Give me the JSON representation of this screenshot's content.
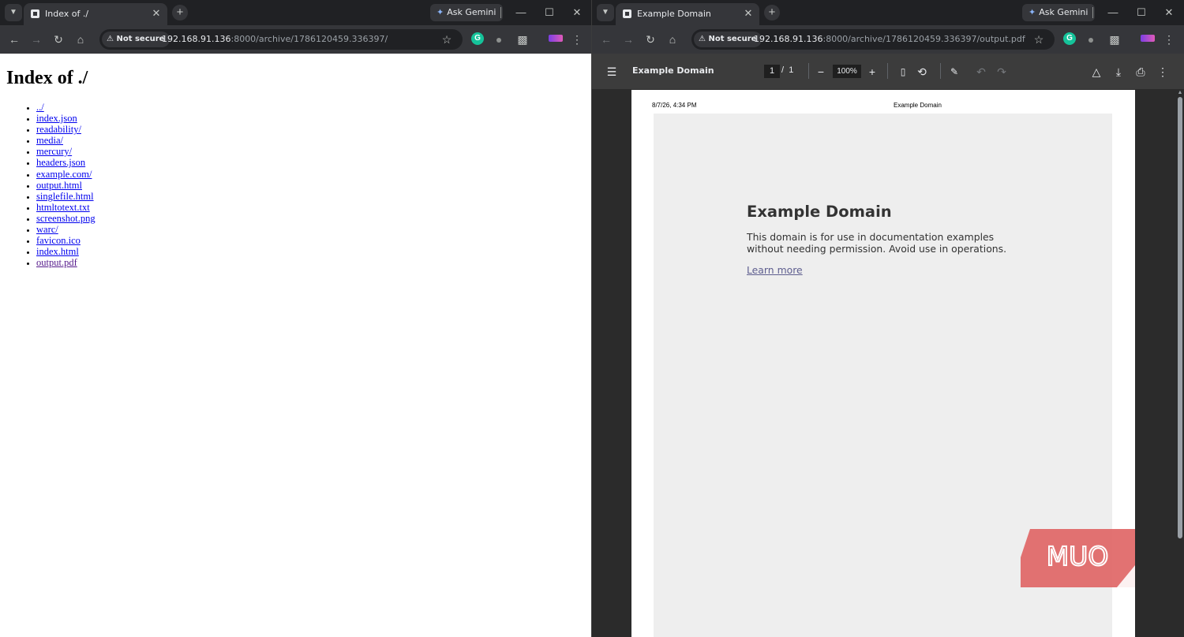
{
  "left_window": {
    "tab_title": "Index of ./",
    "gemini_label": "Ask Gemini",
    "security_chip": "Not secure",
    "url_host": "192.168.91.136",
    "url_rest": ":8000/archive/1786120459.336397/",
    "page": {
      "heading": "Index of ./",
      "items": [
        {
          "label": "../",
          "visited": false
        },
        {
          "label": "index.json",
          "visited": false
        },
        {
          "label": "readability/",
          "visited": false
        },
        {
          "label": "media/",
          "visited": false
        },
        {
          "label": "mercury/",
          "visited": false
        },
        {
          "label": "headers.json",
          "visited": false
        },
        {
          "label": "example.com/",
          "visited": false
        },
        {
          "label": "output.html",
          "visited": false
        },
        {
          "label": "singlefile.html",
          "visited": false
        },
        {
          "label": "htmltotext.txt",
          "visited": false
        },
        {
          "label": "screenshot.png",
          "visited": false
        },
        {
          "label": "warc/",
          "visited": false
        },
        {
          "label": "favicon.ico",
          "visited": false
        },
        {
          "label": "index.html",
          "visited": false
        },
        {
          "label": "output.pdf",
          "visited": true
        }
      ]
    }
  },
  "right_window": {
    "tab_title": "Example Domain",
    "gemini_label": "Ask Gemini",
    "security_chip": "Not secure",
    "url_host": "192.168.91.136",
    "url_rest": ":8000/archive/1786120459.336397/output.pdf",
    "pdf_toolbar": {
      "title": "Example Domain",
      "current_page": "1",
      "page_separator": "/",
      "total_pages": "1",
      "zoom": "100%"
    },
    "pdf_page": {
      "header_date": "8/7/26, 4:34 PM",
      "header_title": "Example Domain",
      "heading": "Example Domain",
      "paragraph": "This domain is for use in documentation examples without needing permission. Avoid use in operations.",
      "link": "Learn more"
    },
    "watermark": "MUO"
  },
  "colors": {
    "chrome_frame": "#202124",
    "chrome_toolbar": "#35363a",
    "link": "#0000ee",
    "visited_link": "#551a8b",
    "watermark": "#e06666"
  }
}
